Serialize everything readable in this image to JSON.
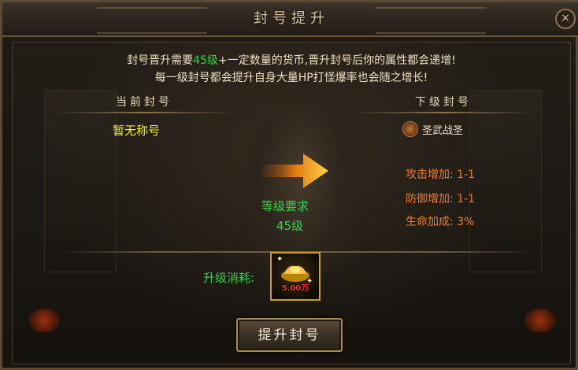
{
  "window": {
    "title": "封号提升",
    "close_icon": "×"
  },
  "info": {
    "line1_prefix": "封号晋升需要",
    "line1_level": "45级",
    "line1_suffix": "+一定数量的货币,晋升封号后你的属性都会递增!",
    "line2": "每一级封号都会提升自身大量HP打怪爆率也会随之增长!"
  },
  "current": {
    "heading": "当前封号",
    "title": "暂无称号"
  },
  "next": {
    "heading": "下级封号",
    "title": "圣武战圣",
    "icon": "title-badge-icon",
    "stats": [
      {
        "label": "攻击增加:",
        "value": "1-1"
      },
      {
        "label": "防御增加:",
        "value": "1-1"
      },
      {
        "label": "生命加成:",
        "value": "3%"
      }
    ]
  },
  "requirement": {
    "label": "等级要求",
    "value": "45级"
  },
  "cost": {
    "label": "升级消耗:",
    "amount": "5.00万",
    "icon": "gold-ingot-icon"
  },
  "upgrade_button": {
    "label": "提升封号"
  },
  "colors": {
    "highlight_green": "#39d24a",
    "title_yellow": "#f2ee3a",
    "stat_orange": "#f07c2c",
    "cost_red": "#ff2a2a",
    "gold_border": "#c9a02a"
  }
}
